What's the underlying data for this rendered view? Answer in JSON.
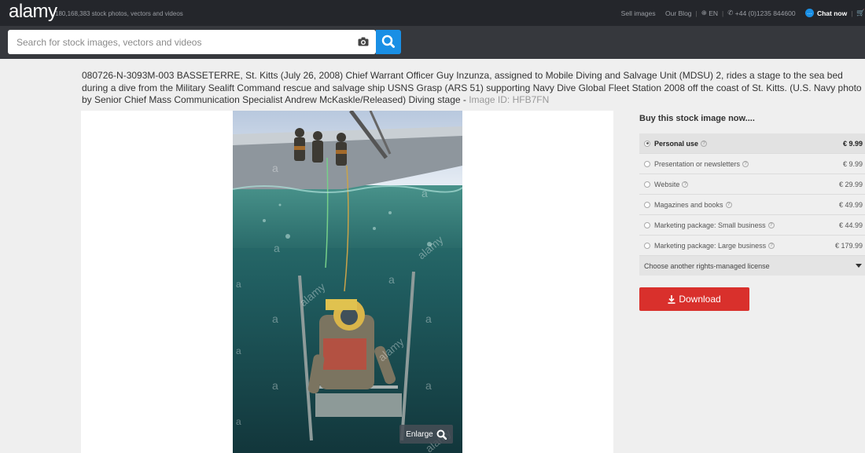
{
  "header": {
    "logo": "alamy",
    "tagline": "180,168,383 stock photos, vectors and videos",
    "sell_images": "Sell images",
    "our_blog": "Our Blog",
    "language": "EN",
    "phone": "+44 (0)1235 844600",
    "chat": "Chat now"
  },
  "search": {
    "placeholder": "Search for stock images, vectors and videos",
    "value": ""
  },
  "description": {
    "text": "080726-N-3093M-003 BASSETERRE, St. Kitts (July 26, 2008) Chief Warrant Officer Guy Inzunza, assigned to Mobile Diving and Salvage Unit (MDSU) 2, rides a stage to the sea bed during a dive from the Military Sealift Command rescue and salvage ship USNS Grasp (ARS 51) supporting Navy Dive Global Fleet Station 2008 off the coast of St. Kitts. (U.S. Navy photo by Senior Chief Mass Communication Specialist Andrew McKaskle/Released) Diving stage - ",
    "image_id": "Image ID: HFB7FN"
  },
  "image": {
    "watermark": "a",
    "watermark_word": "alamy",
    "enlarge": "Enlarge"
  },
  "purchase": {
    "title": "Buy this stock image now....",
    "options": [
      {
        "label": "Personal use",
        "price": "€ 9.99",
        "selected": true
      },
      {
        "label": "Presentation or newsletters",
        "price": "€ 9.99",
        "selected": false
      },
      {
        "label": "Website",
        "price": "€ 29.99",
        "selected": false
      },
      {
        "label": "Magazines and books",
        "price": "€ 49.99",
        "selected": false
      },
      {
        "label": "Marketing package: Small business",
        "price": "€ 44.99",
        "selected": false
      },
      {
        "label": "Marketing package: Large business",
        "price": "€ 179.99",
        "selected": false
      }
    ],
    "other_license": "Choose another rights-managed license",
    "download": "Download"
  },
  "colors": {
    "topbar": "#24262b",
    "searchbar": "#36383d",
    "accent_blue": "#1a8fe5",
    "download_red": "#d9302c"
  }
}
